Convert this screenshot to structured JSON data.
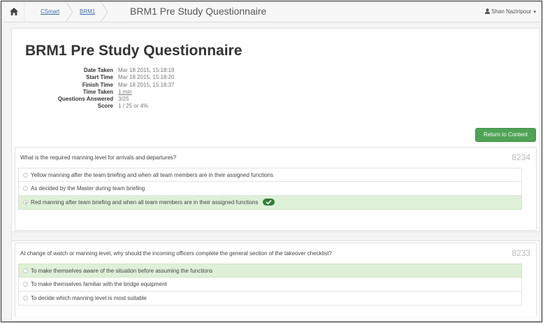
{
  "nav": {
    "home_icon": "home-icon",
    "breadcrumbs": [
      {
        "label": "CSmart"
      },
      {
        "label": "BRM1"
      }
    ],
    "current": "BRM1 Pre Study Questionnaire",
    "user": {
      "name": "Shan Naziripour",
      "icon": "user-icon",
      "caret": "▾"
    }
  },
  "page": {
    "title": "BRM1 Pre Study Questionnaire",
    "details": [
      {
        "label": "Date Taken",
        "value": "Mar 18 2015, 15:18:19"
      },
      {
        "label": "Start Time",
        "value": "Mar 18 2015, 15:18:20"
      },
      {
        "label": "Finish Time",
        "value": "Mar 18 2015, 15:18:37"
      },
      {
        "label": "Time Taken",
        "value": "1 min"
      },
      {
        "label": "Questions Answered",
        "value": "3/25"
      },
      {
        "label": "Score",
        "value": "1 / 25 or 4%"
      }
    ],
    "return_button": "Return to Content"
  },
  "questions": [
    {
      "text": "What is the required manning level for arrivals and departures?",
      "id": "8234",
      "answers": [
        {
          "label": "Yellow manning after the team briefing and when all team members are in their assigned functions",
          "selected": false,
          "correct": false
        },
        {
          "label": "As decided by the Master during team briefing",
          "selected": false,
          "correct": false
        },
        {
          "label": "Red manning after team briefing and when all team members are in their assigned functions",
          "selected": true,
          "correct": true
        }
      ]
    },
    {
      "text": "At change of watch or manning level, why should the incoming officers complete the general section of the takeover checklist?",
      "id": "8233",
      "answers": [
        {
          "label": "To make themselves aware of the situation before assuming the functions",
          "selected": false,
          "correct": true
        },
        {
          "label": "To make themselves familiar with the bridge equipment",
          "selected": false,
          "correct": false
        },
        {
          "label": "To decide which manning level is most suitable",
          "selected": false,
          "correct": false
        }
      ]
    }
  ],
  "colors": {
    "accent_green": "#4fa356",
    "correct_bg": "#dff0d8",
    "link": "#3a6fb0"
  }
}
